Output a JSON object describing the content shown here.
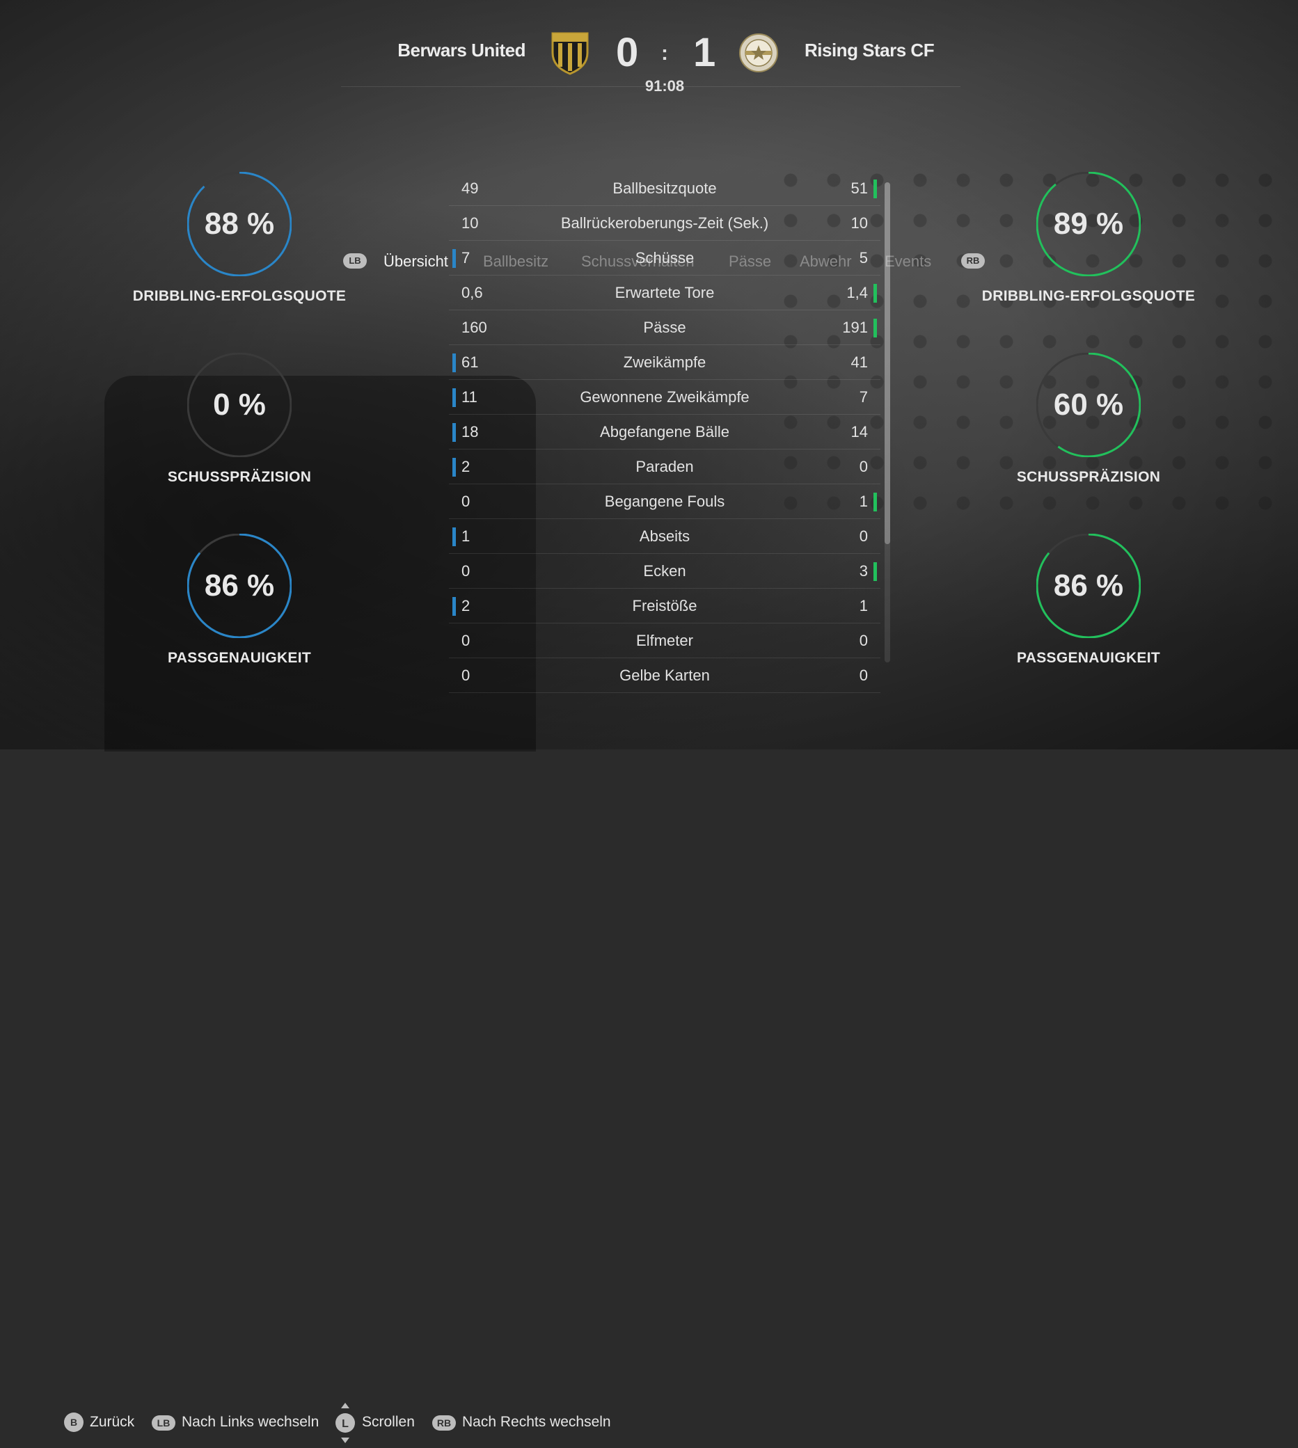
{
  "header": {
    "home_team": "Berwars United",
    "away_team": "Rising Stars CF",
    "home_score": "0",
    "away_score": "1",
    "separator": ":",
    "clock": "91:08"
  },
  "tabs": {
    "lb": "LB",
    "rb": "RB",
    "items": [
      {
        "label": "Übersicht",
        "active": true
      },
      {
        "label": "Ballbesitz",
        "active": false
      },
      {
        "label": "Schussverhalten",
        "active": false
      },
      {
        "label": "Pässe",
        "active": false
      },
      {
        "label": "Abwehr",
        "active": false
      },
      {
        "label": "Events",
        "active": false
      }
    ]
  },
  "home_rings": [
    {
      "value": "88 %",
      "label": "DRIBBLING-ERFOLGSQUOTE",
      "fraction": 0.88
    },
    {
      "value": "0 %",
      "label": "SCHUSSPRÄZISION",
      "fraction": 0.0
    },
    {
      "value": "86 %",
      "label": "PASSGENAUIGKEIT",
      "fraction": 0.86
    }
  ],
  "away_rings": [
    {
      "value": "89 %",
      "label": "DRIBBLING-ERFOLGSQUOTE",
      "fraction": 0.89
    },
    {
      "value": "60 %",
      "label": "SCHUSSPRÄZISION",
      "fraction": 0.6
    },
    {
      "value": "86 %",
      "label": "PASSGENAUIGKEIT",
      "fraction": 0.86
    }
  ],
  "stats": [
    {
      "home": "49",
      "label": "Ballbesitzquote",
      "away": "51",
      "leader": "away"
    },
    {
      "home": "10",
      "label": "Ballrückeroberungs-Zeit (Sek.)",
      "away": "10",
      "leader": "none"
    },
    {
      "home": "7",
      "label": "Schüsse",
      "away": "5",
      "leader": "home"
    },
    {
      "home": "0,6",
      "label": "Erwartete Tore",
      "away": "1,4",
      "leader": "away"
    },
    {
      "home": "160",
      "label": "Pässe",
      "away": "191",
      "leader": "away"
    },
    {
      "home": "61",
      "label": "Zweikämpfe",
      "away": "41",
      "leader": "home"
    },
    {
      "home": "11",
      "label": "Gewonnene Zweikämpfe",
      "away": "7",
      "leader": "home"
    },
    {
      "home": "18",
      "label": "Abgefangene Bälle",
      "away": "14",
      "leader": "home"
    },
    {
      "home": "2",
      "label": "Paraden",
      "away": "0",
      "leader": "home"
    },
    {
      "home": "0",
      "label": "Begangene Fouls",
      "away": "1",
      "leader": "away"
    },
    {
      "home": "1",
      "label": "Abseits",
      "away": "0",
      "leader": "home"
    },
    {
      "home": "0",
      "label": "Ecken",
      "away": "3",
      "leader": "away"
    },
    {
      "home": "2",
      "label": "Freistöße",
      "away": "1",
      "leader": "home"
    },
    {
      "home": "0",
      "label": "Elfmeter",
      "away": "0",
      "leader": "none"
    },
    {
      "home": "0",
      "label": "Gelbe Karten",
      "away": "0",
      "leader": "none"
    }
  ],
  "footer": {
    "back_key": "B",
    "back_label": "Zurück",
    "left_key": "LB",
    "left_label": "Nach Links wechseln",
    "scroll_key": "L",
    "scroll_label": "Scrollen",
    "right_key": "RB",
    "right_label": "Nach Rechts wechseln"
  },
  "colors": {
    "home": "#2a86c8",
    "away": "#22c05c",
    "ring_track": "#3a3a3a"
  }
}
